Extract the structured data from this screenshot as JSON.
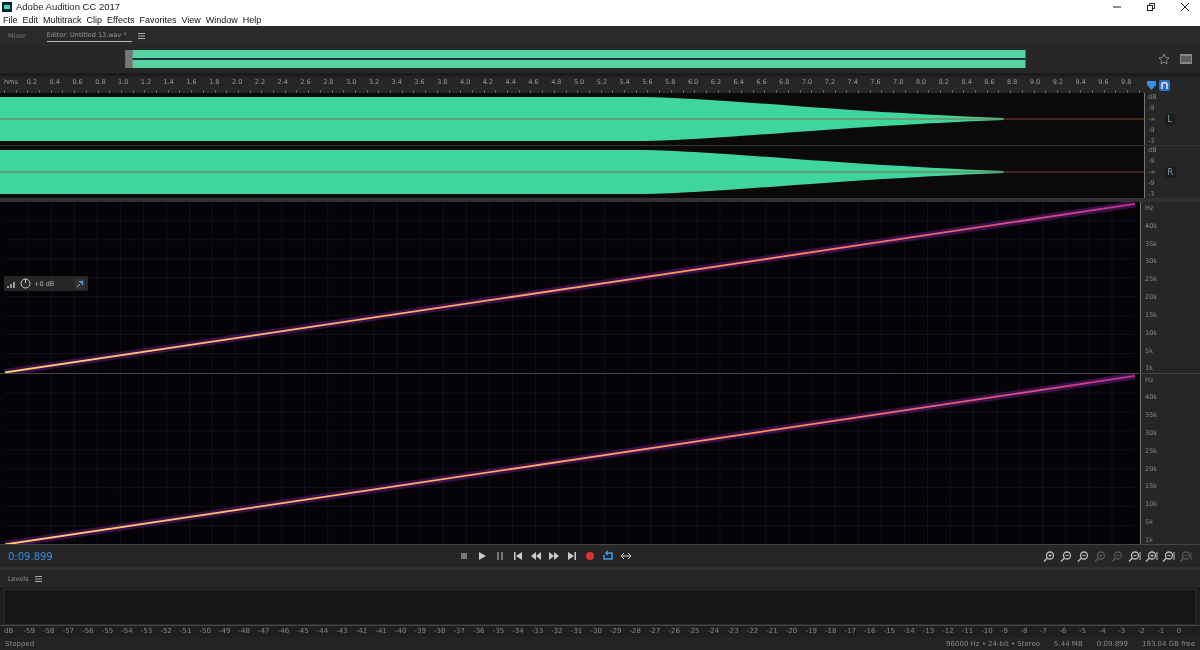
{
  "window": {
    "title": "Adobe Audition CC 2017"
  },
  "menu": [
    "File",
    "Edit",
    "Multitrack",
    "Clip",
    "Effects",
    "Favorites",
    "View",
    "Window",
    "Help"
  ],
  "panel_tabs": [
    {
      "label": "Mixer",
      "selected": false
    },
    {
      "label": "Editor: Untitled 13.wav *",
      "selected": true
    }
  ],
  "ruler": {
    "unit": "hms",
    "ticks": [
      "0.2",
      "0.4",
      "0.6",
      "0.8",
      "1.0",
      "1.2",
      "1.4",
      "1.6",
      "1.8",
      "2.0",
      "2.2",
      "2.4",
      "2.6",
      "2.8",
      "3.0",
      "3.2",
      "3.4",
      "3.6",
      "3.8",
      "4.0",
      "4.2",
      "4.4",
      "4.6",
      "4.8",
      "5.0",
      "5.2",
      "5.4",
      "5.6",
      "5.8",
      "6.0",
      "6.2",
      "6.4",
      "6.6",
      "6.8",
      "7.0",
      "7.2",
      "7.4",
      "7.6",
      "7.8",
      "8.0",
      "8.2",
      "8.4",
      "8.6",
      "8.8",
      "9.0",
      "9.2",
      "9.4",
      "9.6",
      "9.8"
    ]
  },
  "waveform": {
    "channels": [
      {
        "label": "L",
        "scale": [
          "dB",
          "-9",
          "-∞",
          "-9",
          "-3"
        ]
      },
      {
        "label": "R",
        "scale": [
          "dB",
          "-9",
          "-∞",
          "-9",
          "-3"
        ]
      }
    ]
  },
  "spectrogram": {
    "channels": [
      {
        "scale": [
          "Hz",
          "40k",
          "35k",
          "30k",
          "25k",
          "20k",
          "15k",
          "10k",
          "5k",
          "1k"
        ]
      },
      {
        "scale": [
          "Hz",
          "40k",
          "35k",
          "30k",
          "25k",
          "20k",
          "15k",
          "10k",
          "5k",
          "1k"
        ]
      }
    ]
  },
  "hud": {
    "gain": "+0 dB"
  },
  "transport": {
    "time": "0:09.899",
    "buttons": [
      {
        "kind": "stop",
        "on": false
      },
      {
        "kind": "play",
        "on": false
      },
      {
        "kind": "pause",
        "on": false
      },
      {
        "kind": "start",
        "on": false
      },
      {
        "kind": "rewind",
        "on": false
      },
      {
        "kind": "forward",
        "on": false
      },
      {
        "kind": "end",
        "on": false
      },
      {
        "kind": "record",
        "on": false
      },
      {
        "kind": "loop",
        "on": true
      },
      {
        "kind": "skip",
        "on": false
      }
    ],
    "zoom": [
      {
        "disabled": false
      },
      {
        "disabled": false
      },
      {
        "disabled": false
      },
      {
        "disabled": true
      },
      {
        "disabled": true
      },
      {
        "disabled": false
      },
      {
        "disabled": false
      },
      {
        "disabled": false
      },
      {
        "disabled": true
      }
    ]
  },
  "levels": {
    "title": "Levels",
    "scale": [
      "dB",
      "-59",
      "-58",
      "-57",
      "-56",
      "-55",
      "-54",
      "-53",
      "-52",
      "-51",
      "-50",
      "-49",
      "-48",
      "-47",
      "-46",
      "-45",
      "-44",
      "-43",
      "-42",
      "-41",
      "-40",
      "-39",
      "-38",
      "-37",
      "-36",
      "-35",
      "-34",
      "-33",
      "-32",
      "-31",
      "-30",
      "-29",
      "-28",
      "-27",
      "-26",
      "-25",
      "-24",
      "-23",
      "-22",
      "-21",
      "-20",
      "-19",
      "-18",
      "-17",
      "-16",
      "-15",
      "-14",
      "-13",
      "-12",
      "-11",
      "-10",
      "-9",
      "-8",
      "-7",
      "-6",
      "-5",
      "-4",
      "-3",
      "-2",
      "-1",
      "0"
    ]
  },
  "status_bar": {
    "state": "Stopped",
    "items": [
      "96000 Hz • 24-bit • Stereo",
      "5.44 MB",
      "0:09.899",
      "193.04 GB free"
    ]
  }
}
